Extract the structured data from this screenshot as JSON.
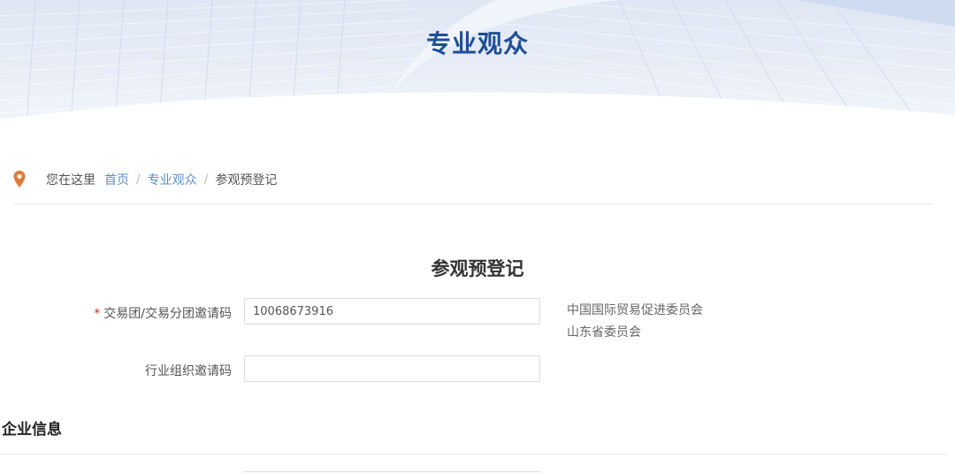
{
  "banner": {
    "title": "专业观众"
  },
  "breadcrumb": {
    "prefix": "您在这里",
    "items": [
      "首页",
      "专业观众"
    ],
    "current": "参观预登记"
  },
  "form": {
    "title": "参观预登记",
    "fields": [
      {
        "label": "交易团/交易分团邀请码",
        "required": true,
        "value": "10068673916"
      },
      {
        "label": "行业组织邀请码",
        "required": false,
        "value": ""
      }
    ],
    "invite_org": [
      "中国国际贸易促进委员会",
      "山东省委员会"
    ]
  },
  "section": {
    "title": "企业信息"
  },
  "colors": {
    "accent": "#1f4f97",
    "link": "#5d8fc8",
    "pin": "#e07a3a",
    "required": "#c0392b"
  }
}
